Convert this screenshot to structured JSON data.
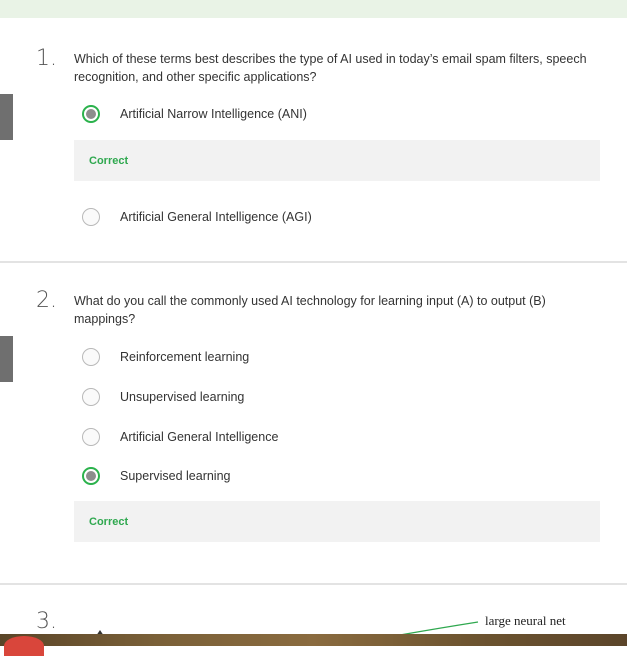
{
  "questions": [
    {
      "number": "1.",
      "text": "Which of these terms best describes the type of AI used in today’s email spam filters, speech recognition, and other specific applications?",
      "options": [
        {
          "label": "Artificial Narrow Intelligence (ANI)",
          "selected": true
        },
        {
          "label": "Artificial General Intelligence (AGI)",
          "selected": false
        }
      ],
      "feedback": "Correct"
    },
    {
      "number": "2.",
      "text": "What do you call the commonly used AI technology for learning input (A) to output (B) mappings?",
      "options": [
        {
          "label": "Reinforcement learning",
          "selected": false
        },
        {
          "label": "Unsupervised learning",
          "selected": false
        },
        {
          "label": "Artificial General Intelligence",
          "selected": false
        },
        {
          "label": "Supervised learning",
          "selected": true
        }
      ],
      "feedback": "Correct"
    },
    {
      "number": "3.",
      "diagram_label": "large neural net"
    }
  ],
  "colors": {
    "correct": "#2fa84f",
    "selected_ring": "#2bb24c",
    "feedback_bg": "#f2f2f2",
    "top_strip": "#e9f3e6"
  }
}
